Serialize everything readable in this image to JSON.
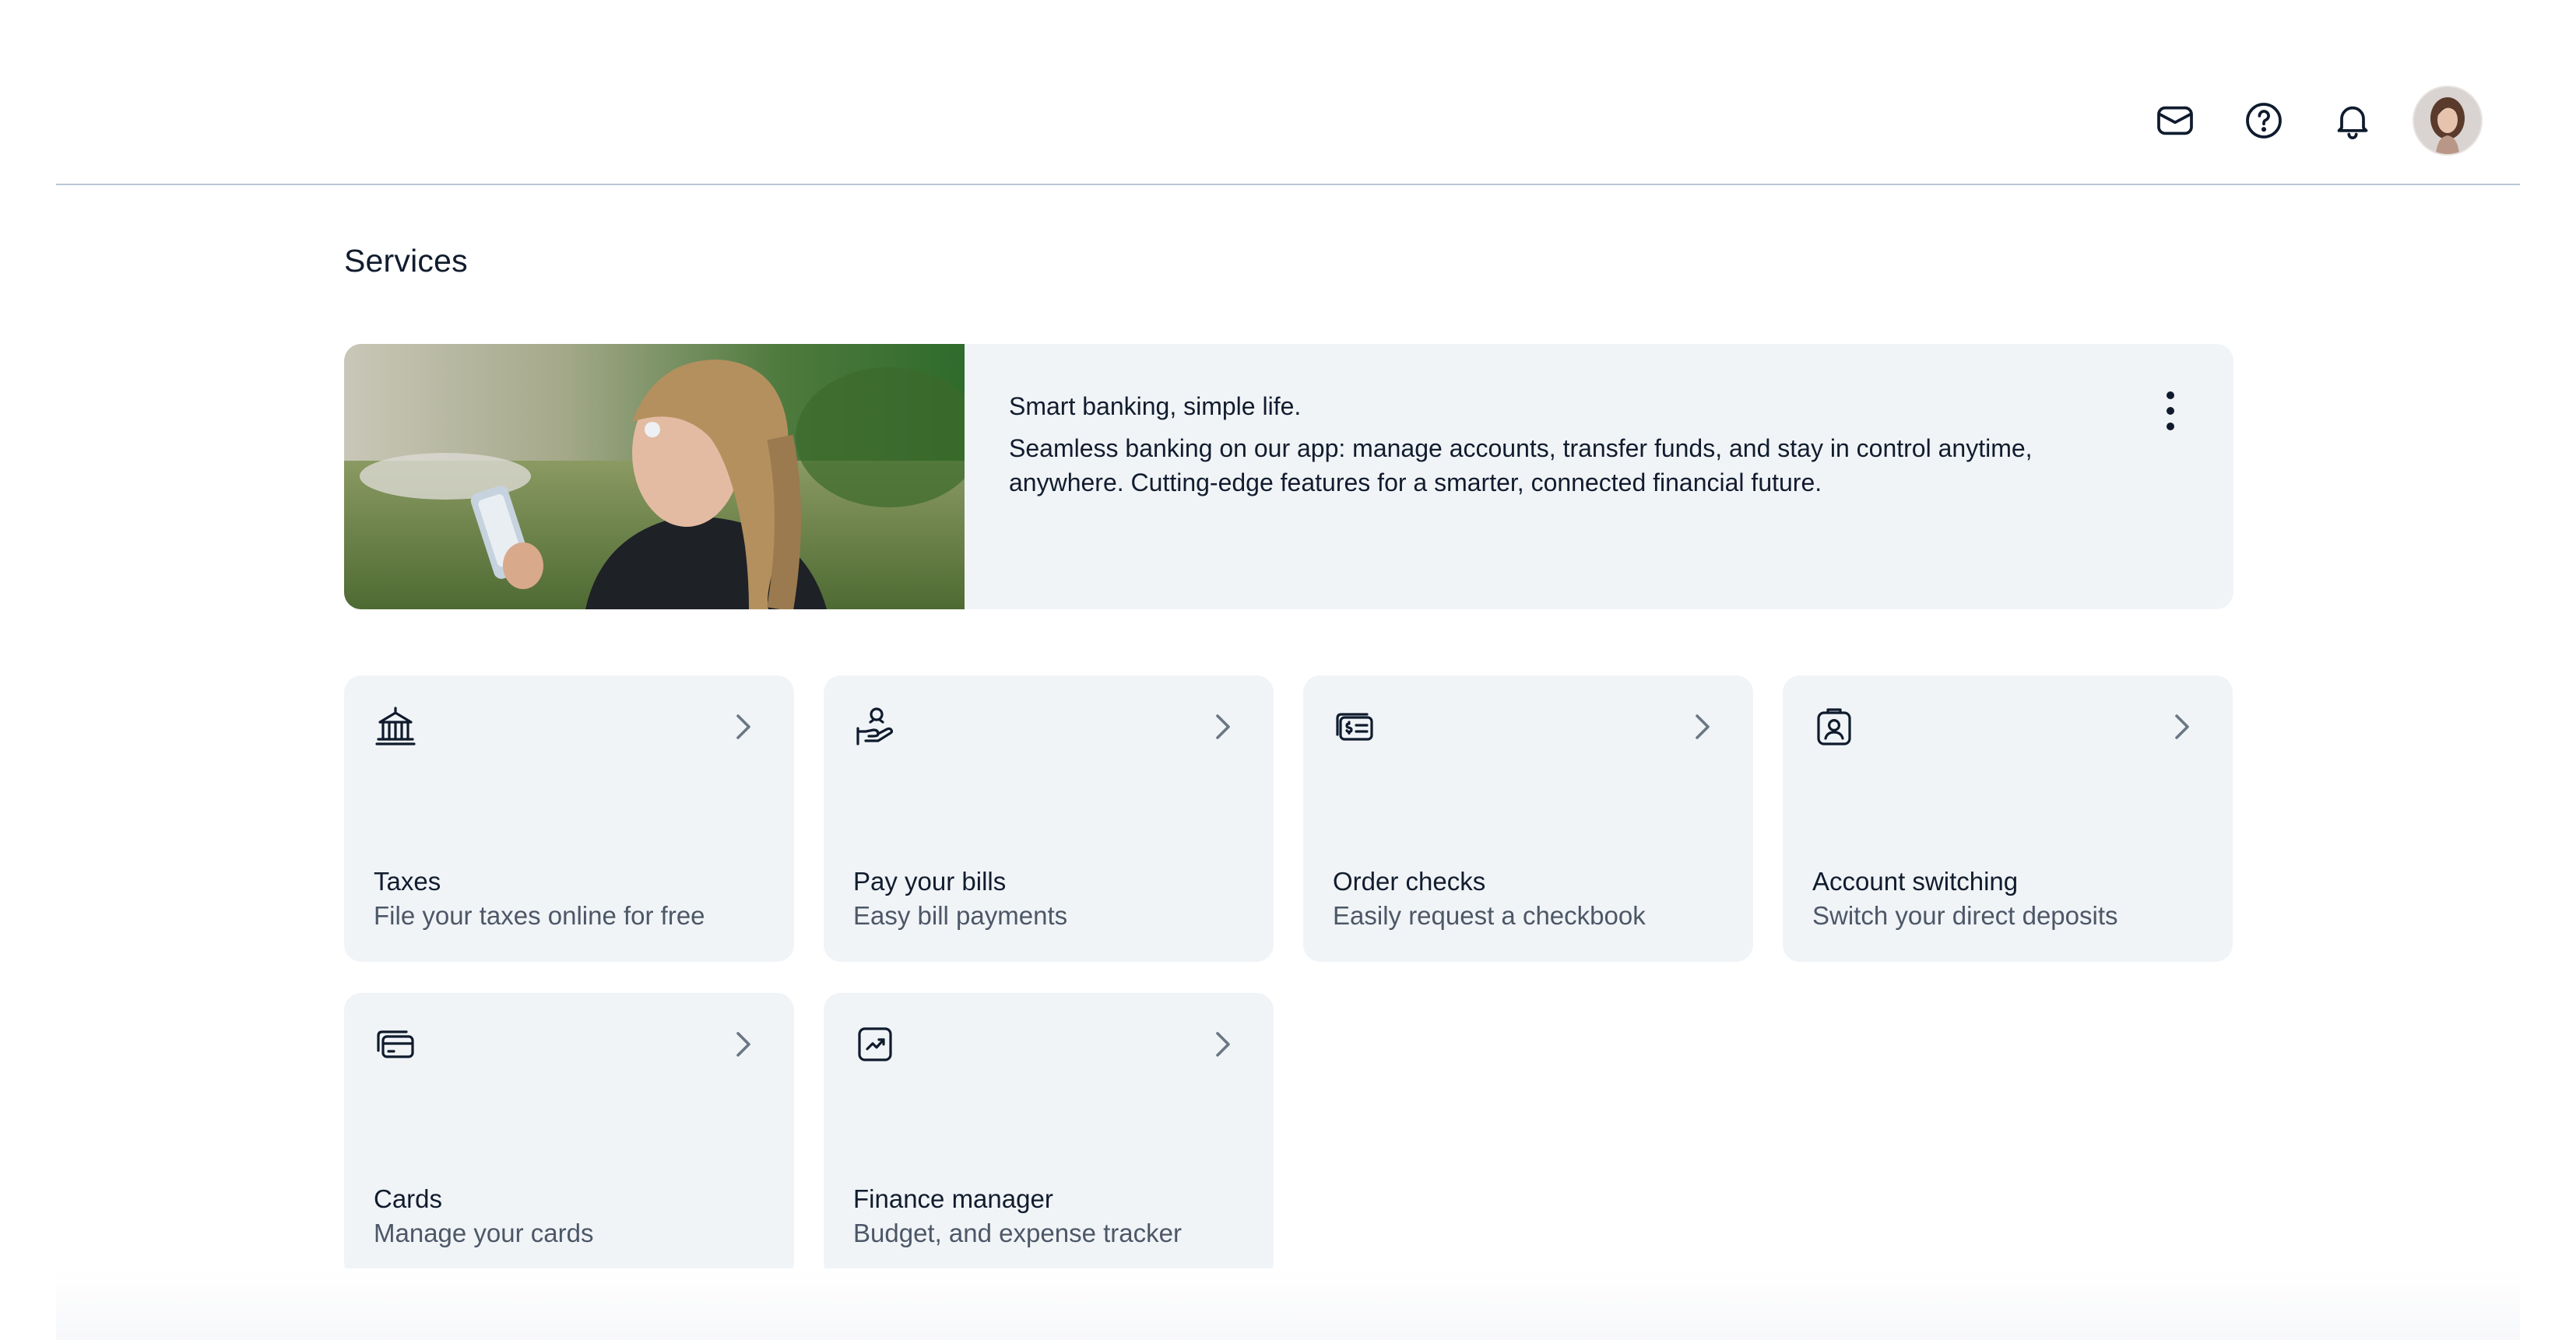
{
  "header": {
    "icons": [
      "mail-icon",
      "help-icon",
      "bell-icon"
    ],
    "avatar_alt": "User profile"
  },
  "page": {
    "title": "Services"
  },
  "banner": {
    "title": "Smart banking, simple life.",
    "description": "Seamless banking on our app: manage accounts, transfer funds, and stay in control anytime, anywhere. Cutting-edge features for a smarter, connected financial future."
  },
  "services": [
    {
      "icon": "bank-building-icon",
      "title": "Taxes",
      "subtitle": "File your taxes online for free"
    },
    {
      "icon": "hand-coin-icon",
      "title": "Pay your bills",
      "subtitle": "Easy bill payments"
    },
    {
      "icon": "checkbook-icon",
      "title": "Order checks",
      "subtitle": "Easily request a checkbook"
    },
    {
      "icon": "id-badge-icon",
      "title": "Account switching",
      "subtitle": "Switch your direct deposits"
    },
    {
      "icon": "cards-icon",
      "title": "Cards",
      "subtitle": "Manage your cards"
    },
    {
      "icon": "chart-trend-icon",
      "title": "Finance manager",
      "subtitle": "Budget, and expense tracker"
    }
  ],
  "colors": {
    "card_bg": "#f1f4f7",
    "text_primary": "#111c2e",
    "text_secondary": "#4c5767",
    "divider": "#b9c6d4"
  }
}
